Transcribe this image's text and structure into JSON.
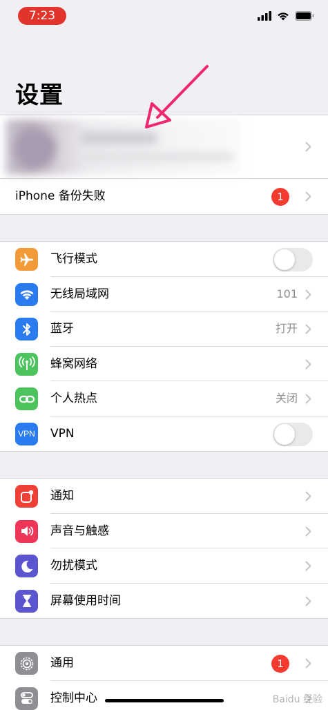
{
  "status_bar": {
    "time": "7:23"
  },
  "page": {
    "title": "设置"
  },
  "account_group": {
    "backup_label": "iPhone 备份失败",
    "backup_badge": "1"
  },
  "network_group": [
    {
      "label": "飞行模式",
      "icon": "airplane-icon",
      "color": "#f29a38",
      "toggle": false
    },
    {
      "label": "无线局域网",
      "icon": "wifi-icon",
      "color": "#2b7bf0",
      "value": "101"
    },
    {
      "label": "蓝牙",
      "icon": "bluetooth-icon",
      "color": "#2b7bf0",
      "value": "打开"
    },
    {
      "label": "蜂窝网络",
      "icon": "cellular-icon",
      "color": "#4cc45e"
    },
    {
      "label": "个人热点",
      "icon": "hotspot-icon",
      "color": "#4cc45e",
      "value": "关闭"
    },
    {
      "label": "VPN",
      "icon": "vpn-icon",
      "icon_text": "VPN",
      "color": "#2b7bf0",
      "toggle": false
    }
  ],
  "notify_group": [
    {
      "label": "通知",
      "icon": "notifications-icon",
      "color": "#ef4036"
    },
    {
      "label": "声音与触感",
      "icon": "sound-icon",
      "color": "#ee3659"
    },
    {
      "label": "勿扰模式",
      "icon": "moon-icon",
      "color": "#5b55cf"
    },
    {
      "label": "屏幕使用时间",
      "icon": "hourglass-icon",
      "color": "#5b55cf"
    }
  ],
  "general_group": [
    {
      "label": "通用",
      "icon": "gear-icon",
      "color": "#8e8e93",
      "badge": "1"
    },
    {
      "label": "控制中心",
      "icon": "control-center-icon",
      "color": "#8e8e93"
    }
  ],
  "watermark": "Baidu 经验"
}
